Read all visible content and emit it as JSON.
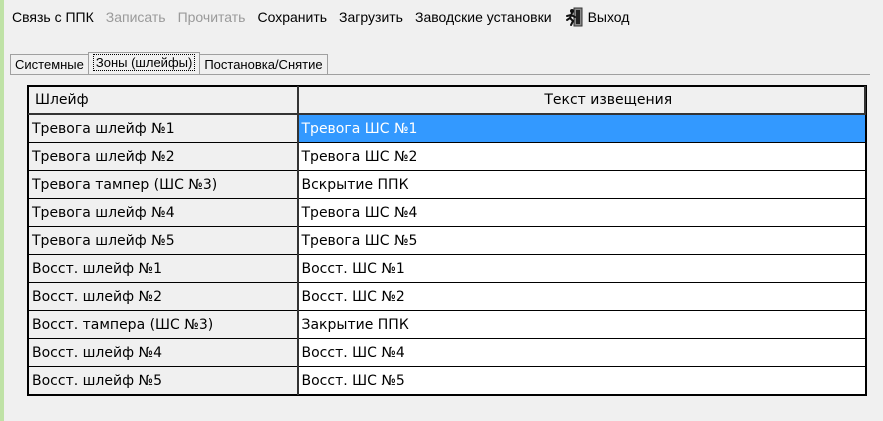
{
  "menu": {
    "items": [
      {
        "label": "Связь с ППК",
        "enabled": true
      },
      {
        "label": "Записать",
        "enabled": false
      },
      {
        "label": "Прочитать",
        "enabled": false
      },
      {
        "label": "Сохранить",
        "enabled": true
      },
      {
        "label": "Загрузить",
        "enabled": true
      },
      {
        "label": "Заводские установки",
        "enabled": true
      }
    ],
    "exit_label": "Выход",
    "exit_icon": "running-man-exit-icon"
  },
  "tabs": [
    {
      "label": "Системные",
      "active": false
    },
    {
      "label": "Зоны (шлейфы)",
      "active": true
    },
    {
      "label": "Постановка/Снятие",
      "active": false
    }
  ],
  "grid": {
    "columns": [
      "Шлейф",
      "Текст извещения"
    ],
    "selected_row": 0,
    "selection_color": "#3399ff",
    "rows": [
      [
        "Тревога шлейф №1",
        "Тревога ШС №1"
      ],
      [
        "Тревога шлейф №2",
        "Тревога ШС №2"
      ],
      [
        "Тревога тампер (ШС №3)",
        "Вскрытие ППК"
      ],
      [
        "Тревога шлейф №4",
        "Тревога ШС №4"
      ],
      [
        "Тревога шлейф №5",
        "Тревога ШС №5"
      ],
      [
        "Восст. шлейф №1",
        "Восст. ШС №1"
      ],
      [
        "Восст. шлейф №2",
        "Восст. ШС №2"
      ],
      [
        "Восст. тампера (ШС №3)",
        "Закрытие ППК"
      ],
      [
        "Восст. шлейф №4",
        "Восст. ШС №4"
      ],
      [
        "Восст. шлейф №5",
        "Восст. ШС №5"
      ]
    ]
  }
}
